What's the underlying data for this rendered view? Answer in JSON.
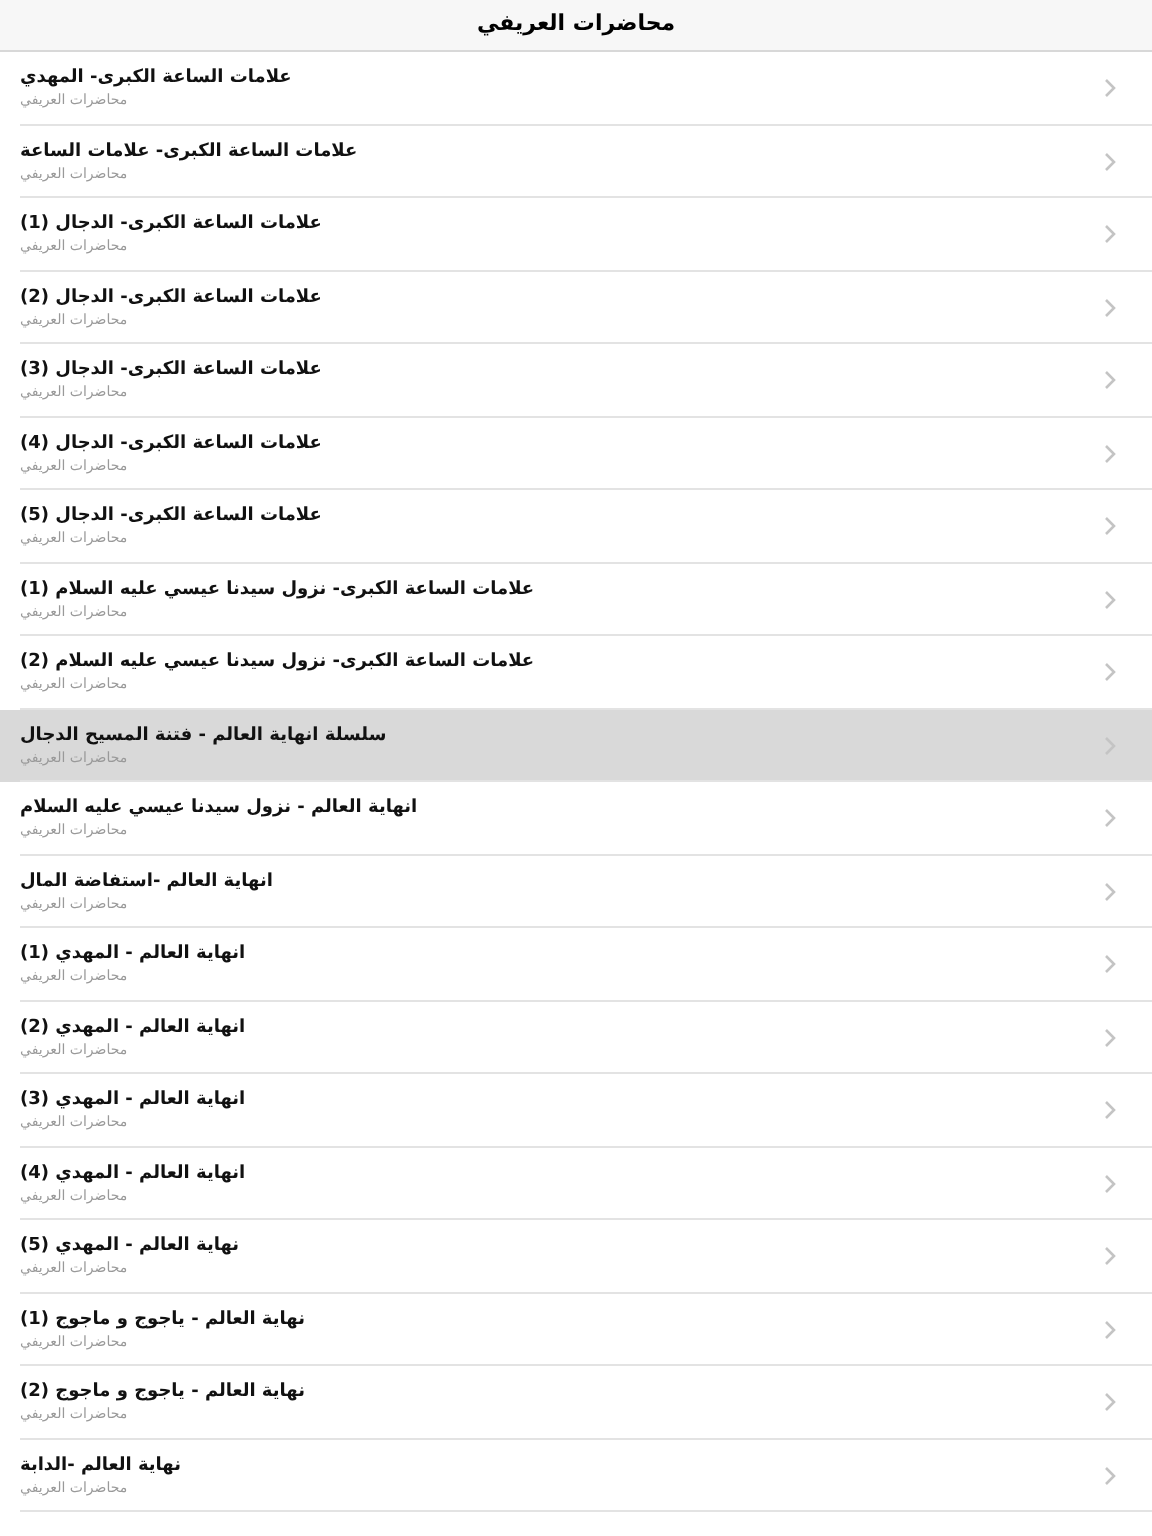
{
  "header": {
    "title": "محاضرات العريفي"
  },
  "items": [
    {
      "title": "علامات الساعة الكبرى- المهدي",
      "subtitle": "محاضرات العريفي",
      "selected": false
    },
    {
      "title": "علامات الساعة الكبرى- علامات الساعة",
      "subtitle": "محاضرات العريفي",
      "selected": false
    },
    {
      "title": "علامات الساعة الكبرى- الدجال (1)",
      "subtitle": "محاضرات العريفي",
      "selected": false
    },
    {
      "title": "علامات الساعة الكبرى- الدجال (2)",
      "subtitle": "محاضرات العريفي",
      "selected": false
    },
    {
      "title": "علامات الساعة الكبرى- الدجال (3)",
      "subtitle": "محاضرات العريفي",
      "selected": false
    },
    {
      "title": "علامات الساعة الكبرى- الدجال (4)",
      "subtitle": "محاضرات العريفي",
      "selected": false
    },
    {
      "title": "علامات الساعة الكبرى- الدجال (5)",
      "subtitle": "محاضرات العريفي",
      "selected": false
    },
    {
      "title": "علامات الساعة الكبرى- نزول سيدنا عيسي عليه السلام (1)",
      "subtitle": "محاضرات العريفي",
      "selected": false
    },
    {
      "title": "علامات الساعة الكبرى- نزول سيدنا عيسي عليه السلام (2)",
      "subtitle": "محاضرات العريفي",
      "selected": false
    },
    {
      "title": "سلسلة انهاية العالم - فتنة المسيح الدجال",
      "subtitle": "محاضرات العريفي",
      "selected": true
    },
    {
      "title": "انهاية العالم  - نزول سيدنا عيسي عليه السلام",
      "subtitle": "محاضرات العريفي",
      "selected": false
    },
    {
      "title": "انهاية العالم -استفاضة المال",
      "subtitle": "محاضرات العريفي",
      "selected": false
    },
    {
      "title": "انهاية العالم - المهدي (1)",
      "subtitle": "محاضرات العريفي",
      "selected": false
    },
    {
      "title": "انهاية العالم - المهدي (2)",
      "subtitle": "محاضرات العريفي",
      "selected": false
    },
    {
      "title": "انهاية العالم - المهدي (3)",
      "subtitle": "محاضرات العريفي",
      "selected": false
    },
    {
      "title": "انهاية العالم - المهدي (4)",
      "subtitle": "محاضرات العريفي",
      "selected": false
    },
    {
      "title": "نهاية العالم - المهدي (5)",
      "subtitle": "محاضرات العريفي",
      "selected": false
    },
    {
      "title": "نهاية العالم - ياجوج و ماجوج (1)",
      "subtitle": "محاضرات العريفي",
      "selected": false
    },
    {
      "title": "نهاية العالم - ياجوج و ماجوج (2)",
      "subtitle": "محاضرات العريفي",
      "selected": false
    },
    {
      "title": "نهاية العالم -الدابة",
      "subtitle": "محاضرات العريفي",
      "selected": false
    }
  ]
}
